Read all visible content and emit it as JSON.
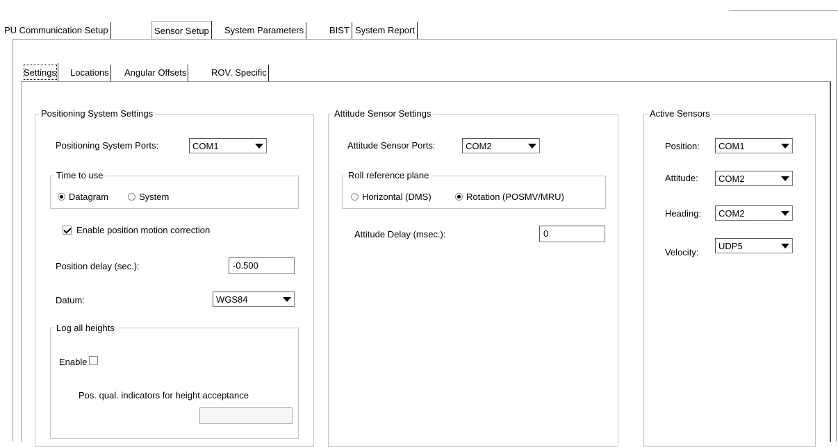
{
  "top_tabs": [
    {
      "label": "PU Communication Setup"
    },
    {
      "label": "Sensor Setup"
    },
    {
      "label": "System Parameters"
    },
    {
      "label": "BIST"
    },
    {
      "label": "System Report"
    }
  ],
  "sub_tabs": [
    {
      "label": "Settings"
    },
    {
      "label": "Locations"
    },
    {
      "label": "Angular Offsets"
    },
    {
      "label": "ROV. Specific"
    }
  ],
  "positioning": {
    "title": "Positioning System Settings",
    "ports_label": "Positioning System Ports:",
    "ports_value": "COM1",
    "time_group": "Time to use",
    "time_opt_datagram": "Datagram",
    "time_opt_system": "System",
    "time_selected": "Datagram",
    "motion_correction_label": "Enable position motion correction",
    "motion_correction_checked": true,
    "delay_label": "Position delay (sec.):",
    "delay_value": "-0.500",
    "datum_label": "Datum:",
    "datum_value": "WGS84",
    "log_heights_group": "Log all heights",
    "enable_label": "Enable",
    "enable_checked": false,
    "pos_qual_label": "Pos. qual. indicators for height acceptance",
    "pos_qual_value": ""
  },
  "attitude": {
    "title": "Attitude Sensor Settings",
    "ports_label": "Attitude Sensor Ports:",
    "ports_value": "COM2",
    "roll_group": "Roll reference plane",
    "roll_opt_horizontal": "Horizontal (DMS)",
    "roll_opt_rotation": "Rotation (POSMV/MRU)",
    "roll_selected": "Rotation (POSMV/MRU)",
    "delay_label": "Attitude Delay (msec.):",
    "delay_value": "0"
  },
  "active_sensors": {
    "title": "Active Sensors",
    "position_label": "Position:",
    "position_value": "COM1",
    "attitude_label": "Attitude:",
    "attitude_value": "COM2",
    "heading_label": "Heading:",
    "heading_value": "COM2",
    "velocity_label": "Velocity:",
    "velocity_value": "UDP5"
  }
}
